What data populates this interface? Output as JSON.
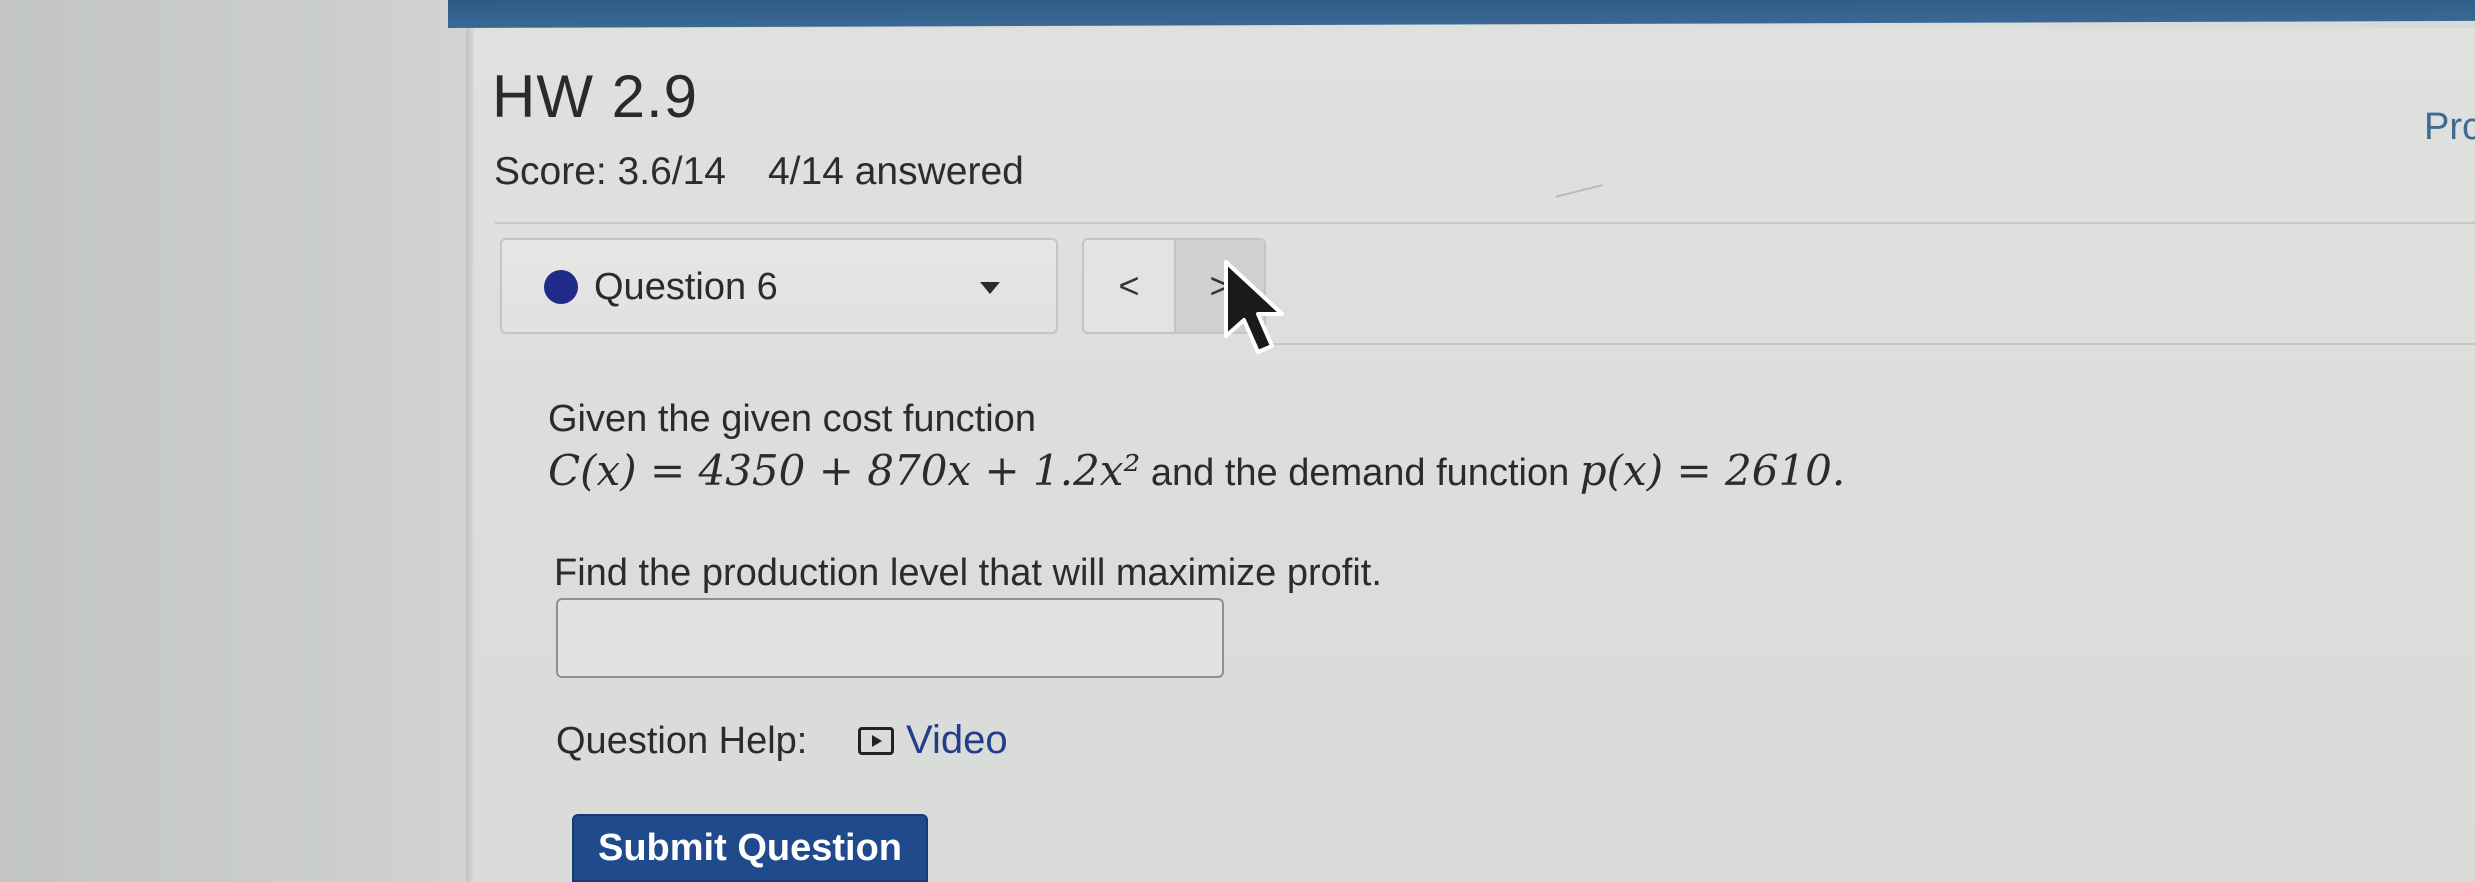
{
  "assignment": {
    "title": "HW 2.9",
    "score": "Score: 3.6/14",
    "answered": "4/14 answered",
    "progress_label": "Prc"
  },
  "question_nav": {
    "selected": "Question 6",
    "prev_label": "<",
    "next_label": ">"
  },
  "question": {
    "intro": "Given the given cost function",
    "cost_function": "C(x) = 4350 + 870x + 1.2x²",
    "connector": "and the demand function",
    "demand_function": "p(x) = 2610.",
    "instruction": "Find the production level that will maximize profit.",
    "answer_value": ""
  },
  "help": {
    "label": "Question Help:",
    "video_label": "Video"
  },
  "actions": {
    "submit_label": "Submit Question"
  },
  "colors": {
    "top_bar": "#2e5a86",
    "question_dot": "#1f2a8a",
    "link": "#233d8c",
    "submit_bg": "#1f4a8c"
  },
  "icons": {
    "question_status": "filled-circle",
    "dropdown": "caret-down-icon",
    "video": "play-box-icon",
    "cursor": "mouse-pointer-icon"
  }
}
